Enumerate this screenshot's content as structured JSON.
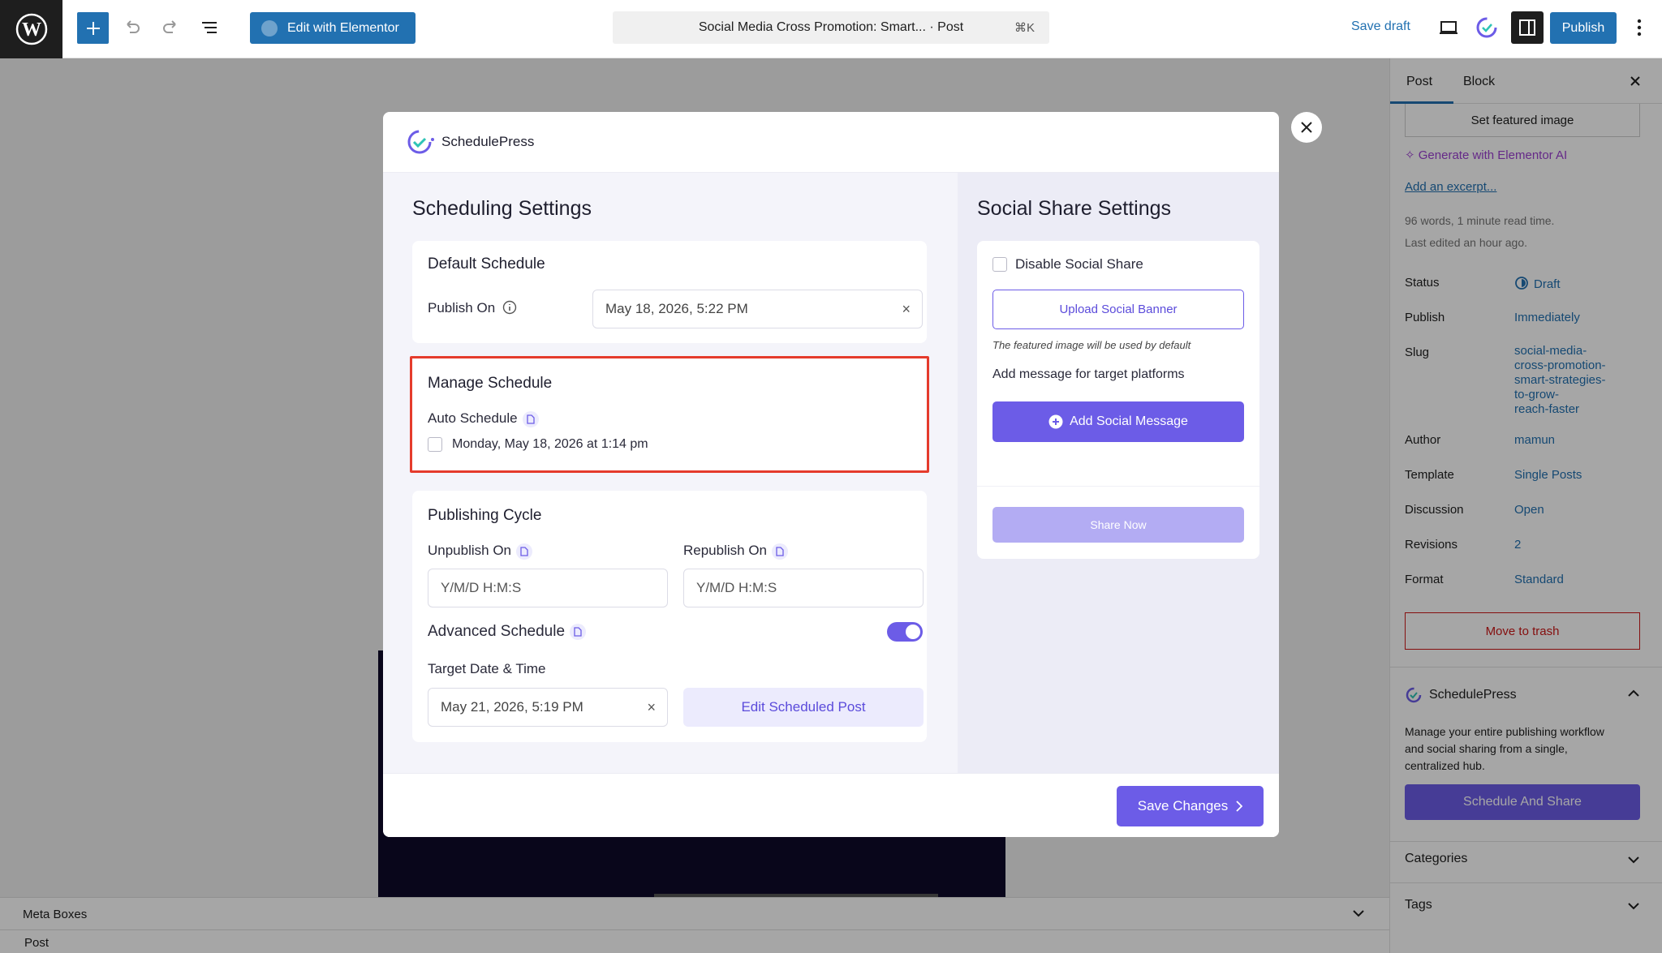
{
  "topbar": {
    "elementor_label": "Edit with Elementor",
    "doc_title": "Social Media Cross Promotion: Smart... · Post",
    "doc_shortcut": "⌘K",
    "save_draft": "Save draft",
    "publish": "Publish"
  },
  "editor": {
    "meta_boxes": "Meta Boxes",
    "post_label": "Post"
  },
  "sidebar": {
    "tab_post": "Post",
    "tab_block": "Block",
    "set_featured": "Set featured image",
    "generate_ai": "Generate with Elementor AI",
    "add_excerpt": "Add an excerpt...",
    "word_count": "96 words, 1 minute read time.",
    "last_edited": "Last edited an hour ago.",
    "rows": {
      "status_label": "Status",
      "status_value": "Draft",
      "publish_label": "Publish",
      "publish_value": "Immediately",
      "slug_label": "Slug",
      "slug_value_1": "social-media-",
      "slug_value_2": "cross-promotion-",
      "slug_value_3": "smart-strategies-",
      "slug_value_4": "to-grow-",
      "slug_value_5": "reach-faster",
      "author_label": "Author",
      "author_value": "mamun",
      "template_label": "Template",
      "template_value": "Single Posts",
      "discussion_label": "Discussion",
      "discussion_value": "Open",
      "revisions_label": "Revisions",
      "revisions_value": "2",
      "format_label": "Format",
      "format_value": "Standard"
    },
    "move_trash": "Move to trash",
    "sp_title": "SchedulePress",
    "sp_desc_1": "Manage your entire publishing workflow",
    "sp_desc_2": "and social sharing from a single,",
    "sp_desc_3": "centralized hub.",
    "sp_button": "Schedule And Share",
    "categories": "Categories",
    "tags": "Tags"
  },
  "modal": {
    "brand": "SchedulePress",
    "scheduling_title": "Scheduling Settings",
    "default_schedule": {
      "title": "Default Schedule",
      "publish_on_label": "Publish On",
      "publish_on_value": "May 18, 2026, 5:22 PM"
    },
    "manage_schedule": {
      "title": "Manage Schedule",
      "auto_label": "Auto Schedule",
      "auto_option": "Monday, May 18, 2026 at 1:14 pm"
    },
    "publishing_cycle": {
      "title": "Publishing Cycle",
      "unpublish_label": "Unpublish On",
      "unpublish_placeholder": "Y/M/D H:M:S",
      "republish_label": "Republish On",
      "republish_placeholder": "Y/M/D H:M:S",
      "advanced_label": "Advanced Schedule",
      "target_label": "Target Date & Time",
      "target_value": "May 21, 2026, 5:19 PM",
      "edit_button": "Edit Scheduled Post"
    },
    "social": {
      "title": "Social Share Settings",
      "disable_label": "Disable Social Share",
      "upload_button": "Upload Social Banner",
      "featured_note": "The featured image will be used by default",
      "message_heading": "Add message for target platforms",
      "add_message": "Add Social Message",
      "share_now": "Share Now"
    },
    "save_changes": "Save Changes"
  },
  "colors": {
    "wp_blue": "#2271b1",
    "accent_purple": "#6c5ce7",
    "highlight_red": "#e53b2c"
  }
}
